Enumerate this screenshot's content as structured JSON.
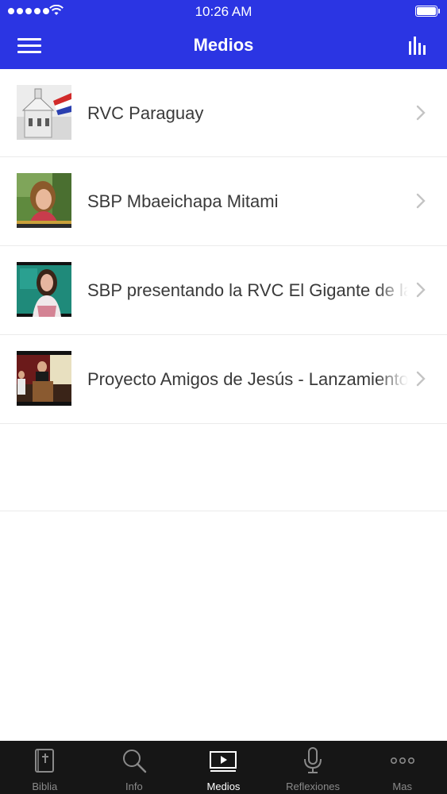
{
  "status_bar": {
    "time": "10:26 AM"
  },
  "header": {
    "title": "Medios"
  },
  "media_list": [
    {
      "title": "RVC Paraguay",
      "thumbnail": "building-flag-thumbnail"
    },
    {
      "title": "SBP Mbaeichapa Mitami",
      "thumbnail": "woman-outdoors-thumbnail"
    },
    {
      "title": "SBP presentando la RVC El Gigante de la Biblia",
      "thumbnail": "presenter-thumbnail"
    },
    {
      "title": "Proyecto Amigos de Jesús - Lanzamiento",
      "thumbnail": "podium-thumbnail"
    }
  ],
  "tab_bar": {
    "tabs": [
      {
        "label": "Biblia",
        "icon": "bible-icon",
        "active": false
      },
      {
        "label": "Info",
        "icon": "search-icon",
        "active": false
      },
      {
        "label": "Medios",
        "icon": "video-play-icon",
        "active": true
      },
      {
        "label": "Reflexiones",
        "icon": "microphone-icon",
        "active": false
      },
      {
        "label": "Mas",
        "icon": "more-dots-icon",
        "active": false
      }
    ]
  },
  "colors": {
    "header_bg": "#2b35e3",
    "tab_bar_bg": "#161616",
    "tab_active": "#ffffff",
    "tab_inactive": "#8a8a8a",
    "row_text": "#3a3a3a"
  }
}
